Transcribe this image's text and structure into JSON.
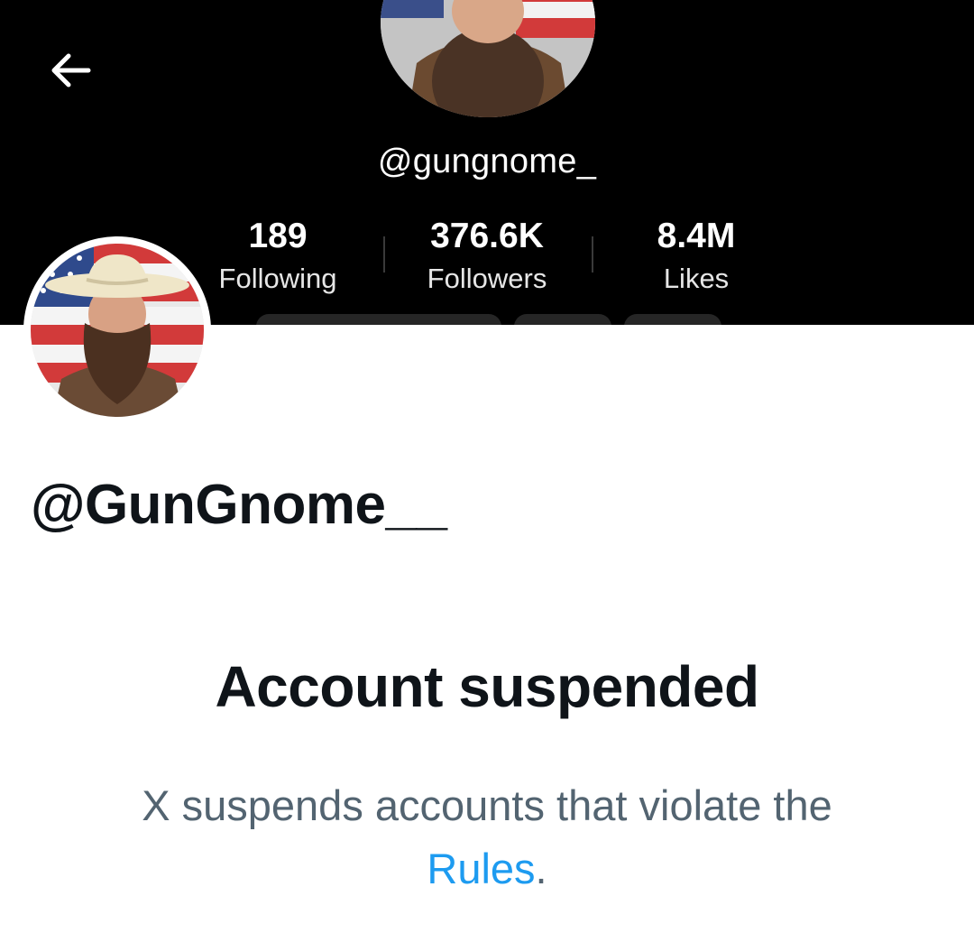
{
  "banner": {
    "handle": "@gungnome_",
    "stats": [
      {
        "value": "189",
        "label": "Following"
      },
      {
        "value": "376.6K",
        "label": "Followers"
      },
      {
        "value": "8.4M",
        "label": "Likes"
      }
    ]
  },
  "profile": {
    "handle": "@GunGnome__"
  },
  "suspension": {
    "title": "Account suspended",
    "message_before": "X suspends accounts that violate the ",
    "link_text": "Rules",
    "message_after": "."
  },
  "colors": {
    "accent": "#1d9bf0",
    "text_primary": "#0f1419",
    "text_secondary": "#536471",
    "banner_bg": "#000000"
  },
  "icons": {
    "back": "arrow-left-icon"
  }
}
